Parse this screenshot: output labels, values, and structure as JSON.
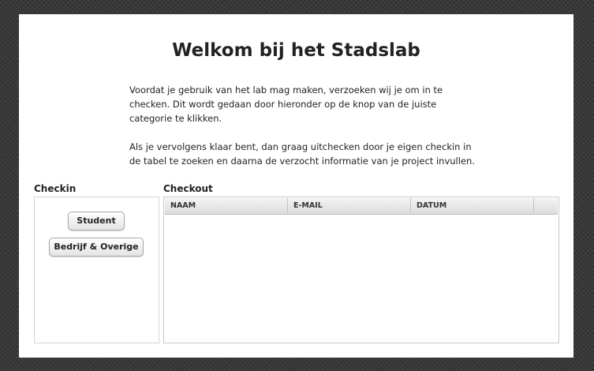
{
  "page": {
    "title": "Welkom bij het Stadslab",
    "intro": [
      "Voordat je gebruik van het lab mag maken, verzoeken wij je om in te checken. Dit wordt gedaan door hieronder op de knop van de juiste categorie te klikken.",
      "Als je vervolgens klaar bent, dan graag uitchecken door je eigen checkin in de tabel te zoeken en daarna de verzocht informatie van je project invullen."
    ]
  },
  "checkin": {
    "label": "Checkin",
    "buttons": [
      "Student",
      "Bedrijf & Overige"
    ]
  },
  "checkout": {
    "label": "Checkout",
    "columns": [
      "NAAM",
      "E-MAIL",
      "DATUM",
      ""
    ],
    "rows": []
  },
  "colors": {
    "background": "#3a3a3a",
    "panel": "#ffffff",
    "text": "#222222"
  }
}
